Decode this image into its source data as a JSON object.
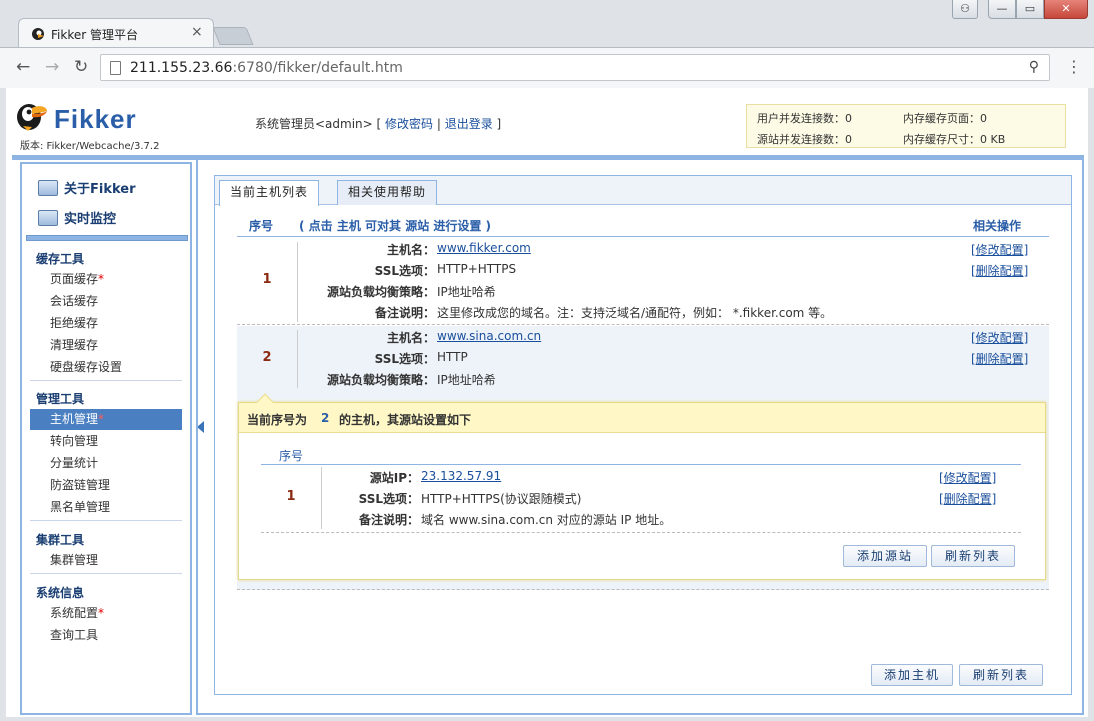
{
  "browser": {
    "tab_title": "Fikker 管理平台",
    "tab_close": "×",
    "url_host": "211.155.23.66",
    "url_rest": ":6780/fikker/default.htm",
    "window_user": "⚇",
    "window_min": "—",
    "window_max": "▭",
    "window_close": "✕"
  },
  "header": {
    "brand": "Fikker",
    "version": "版本: Fikker/Webcache/3.7.2",
    "user_prefix": "系统管理员<admin> [ ",
    "change_password": "修改密码",
    "sep": " | ",
    "logout": "退出登录",
    "user_suffix": " ]",
    "stats": {
      "user_conn": "用户并发连接数：0",
      "mem_pages": "内存缓存页面：0",
      "origin_conn": "源站并发连接数：0",
      "mem_size": "内存缓存尺寸：0 KB"
    }
  },
  "sidebar": {
    "top": [
      "关于Fikker",
      "实时监控"
    ],
    "groups": [
      {
        "title": "缓存工具",
        "items": [
          {
            "label": "页面缓存",
            "star": "*"
          },
          {
            "label": "会话缓存",
            "star": ""
          },
          {
            "label": "拒绝缓存",
            "star": ""
          },
          {
            "label": "清理缓存",
            "star": ""
          },
          {
            "label": "硬盘缓存设置",
            "star": ""
          }
        ]
      },
      {
        "title": "管理工具",
        "items": [
          {
            "label": "主机管理",
            "star": "*"
          },
          {
            "label": "转向管理",
            "star": ""
          },
          {
            "label": "分量统计",
            "star": ""
          },
          {
            "label": "防盗链管理",
            "star": ""
          },
          {
            "label": "黑名单管理",
            "star": ""
          }
        ]
      },
      {
        "title": "集群工具",
        "items": [
          {
            "label": "集群管理",
            "star": ""
          }
        ]
      },
      {
        "title": "系统信息",
        "items": [
          {
            "label": "系统配置",
            "star": "*"
          },
          {
            "label": "查询工具",
            "star": ""
          }
        ]
      }
    ]
  },
  "tabs": [
    "当前主机列表",
    "相关使用帮助"
  ],
  "table": {
    "col_index": "序号",
    "col_desc": "( 点击 主机 可对其 源站 进行设置 )",
    "col_ops": "相关操作"
  },
  "labels": {
    "hostname": "主机名：",
    "ssl": "SSL选项：",
    "lb": "源站负载均衡策略：",
    "note": "备注说明：",
    "origin_ip": "源站IP：",
    "edit": "[修改配置]",
    "delete": "[删除配置]"
  },
  "hosts": [
    {
      "index": "1",
      "hostname": "www.fikker.com",
      "ssl": "HTTP+HTTPS",
      "lb": "IP地址哈希",
      "note": "这里修改成您的域名。注：支持泛域名/通配符，例如： *.fikker.com 等。"
    },
    {
      "index": "2",
      "hostname": "www.sina.com.cn",
      "ssl": "HTTP",
      "lb": "IP地址哈希"
    }
  ],
  "origin_panel": {
    "title_prefix": "当前序号为",
    "title_index": "2",
    "title_suffix": "的主机，其源站设置如下",
    "col_index": "序号",
    "origins": [
      {
        "index": "1",
        "ip": "23.132.57.91",
        "ssl": "HTTP+HTTPS(协议跟随模式)",
        "note": "域名 www.sina.com.cn 对应的源站 IP 地址。"
      }
    ],
    "add_origin": "添加源站",
    "refresh": "刷新列表"
  },
  "footer_buttons": {
    "add_host": "添加主机",
    "refresh": "刷新列表"
  }
}
